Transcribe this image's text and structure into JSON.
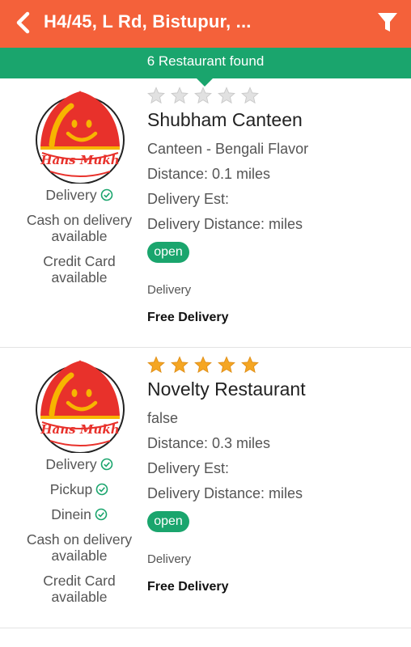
{
  "header": {
    "title": "H4/45, L Rd, Bistupur, ...",
    "back_icon": "back-arrow-icon",
    "filter_icon": "filter-funnel-icon"
  },
  "banner": {
    "text": "6 Restaurant found"
  },
  "colors": {
    "header": "#f4613a",
    "accent_green": "#1aa56d",
    "star_filled": "#f5a623",
    "star_empty": "#d9d9d9"
  },
  "restaurants": [
    {
      "name": "Shubham Canteen",
      "rating": 0,
      "cuisine": "Canteen - Bengali Flavor",
      "distance": "Distance: 0.1 miles",
      "delivery_est": "Delivery Est:",
      "delivery_distance": "Delivery Distance: miles",
      "status": "open",
      "delivery_label": "Delivery",
      "delivery_fee": "Free Delivery",
      "logo_text": "Hans Mukh",
      "features": [
        {
          "label": "Delivery",
          "check": true
        },
        {
          "label": "Cash on delivery available",
          "check": false
        },
        {
          "label": "Credit Card available",
          "check": false
        }
      ]
    },
    {
      "name": "Novelty Restaurant",
      "rating": 5,
      "cuisine": "false",
      "distance": "Distance: 0.3 miles",
      "delivery_est": "Delivery Est:",
      "delivery_distance": "Delivery Distance: miles",
      "status": "open",
      "delivery_label": "Delivery",
      "delivery_fee": "Free Delivery",
      "logo_text": "Hans Mukh",
      "features": [
        {
          "label": "Delivery",
          "check": true
        },
        {
          "label": "Pickup",
          "check": true
        },
        {
          "label": "Dinein",
          "check": true
        },
        {
          "label": "Cash on delivery available",
          "check": false
        },
        {
          "label": "Credit Card available",
          "check": false
        }
      ]
    }
  ]
}
